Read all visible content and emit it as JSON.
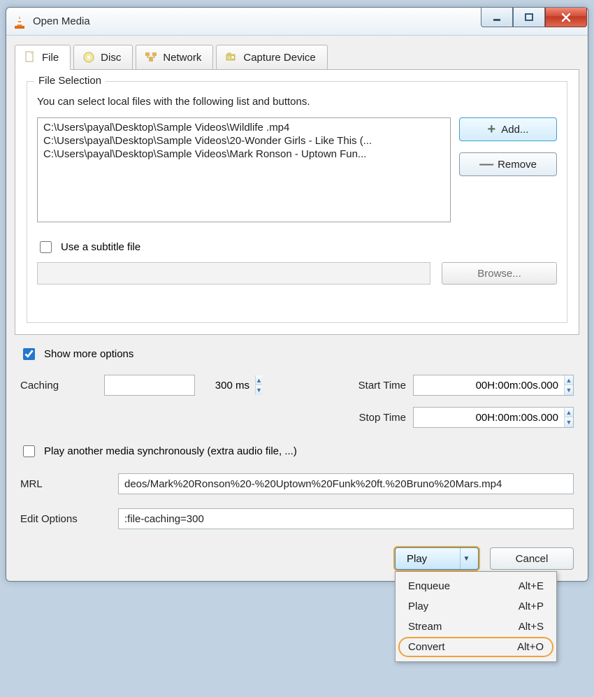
{
  "window": {
    "title": "Open Media"
  },
  "tabs": [
    {
      "label": "File"
    },
    {
      "label": "Disc"
    },
    {
      "label": "Network"
    },
    {
      "label": "Capture Device"
    }
  ],
  "file_selection": {
    "legend": "File Selection",
    "help": "You can select local files with the following list and buttons.",
    "files": [
      "C:\\Users\\payal\\Desktop\\Sample Videos\\Wildlife .mp4",
      "C:\\Users\\payal\\Desktop\\Sample Videos\\20-Wonder Girls - Like This (...",
      "C:\\Users\\payal\\Desktop\\Sample Videos\\Mark Ronson - Uptown Fun..."
    ],
    "add_label": "Add...",
    "remove_label": "Remove"
  },
  "subtitle": {
    "checkbox_label": "Use a subtitle file",
    "browse_label": "Browse..."
  },
  "show_more": {
    "label": "Show more options",
    "checked": true
  },
  "options": {
    "caching_label": "Caching",
    "caching_value": "300 ms",
    "start_label": "Start Time",
    "start_value": "00H:00m:00s.000",
    "stop_label": "Stop Time",
    "stop_value": "00H:00m:00s.000",
    "sync_label": "Play another media synchronously (extra audio file, ...)",
    "mrl_label": "MRL",
    "mrl_value": "deos/Mark%20Ronson%20-%20Uptown%20Funk%20ft.%20Bruno%20Mars.mp4",
    "edit_label": "Edit Options",
    "edit_value": ":file-caching=300"
  },
  "actions": {
    "play_label": "Play",
    "cancel_label": "Cancel",
    "menu": [
      {
        "label": "Enqueue",
        "accel": "Alt+E"
      },
      {
        "label": "Play",
        "accel": "Alt+P"
      },
      {
        "label": "Stream",
        "accel": "Alt+S"
      },
      {
        "label": "Convert",
        "accel": "Alt+O"
      }
    ]
  }
}
